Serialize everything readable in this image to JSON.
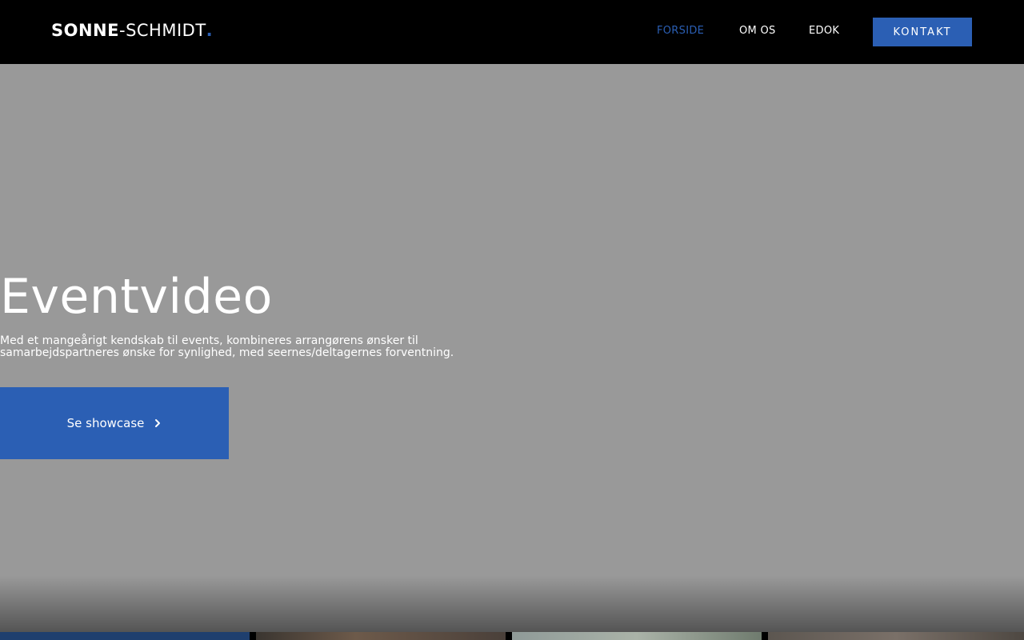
{
  "header": {
    "logo": {
      "part1": "SONNE",
      "dash": "-",
      "part2": "SCHMIDT",
      "dot": "."
    },
    "nav": [
      {
        "label": "FORSIDE"
      },
      {
        "label": "OM OS"
      },
      {
        "label": "EDOK"
      }
    ],
    "cta_label": "KONTAKT"
  },
  "hero": {
    "title": "Eventvideo",
    "description": "Med et mangeårigt kendskab til events, kombineres arrangørens ønsker til samarbejdspartneres ønske for synlighed, med seernes/deltagernes forventning.",
    "button_label": "Se showcase"
  },
  "colors": {
    "accent": "#2b5fb4",
    "hero_background": "#999999",
    "header_background": "#000000"
  }
}
